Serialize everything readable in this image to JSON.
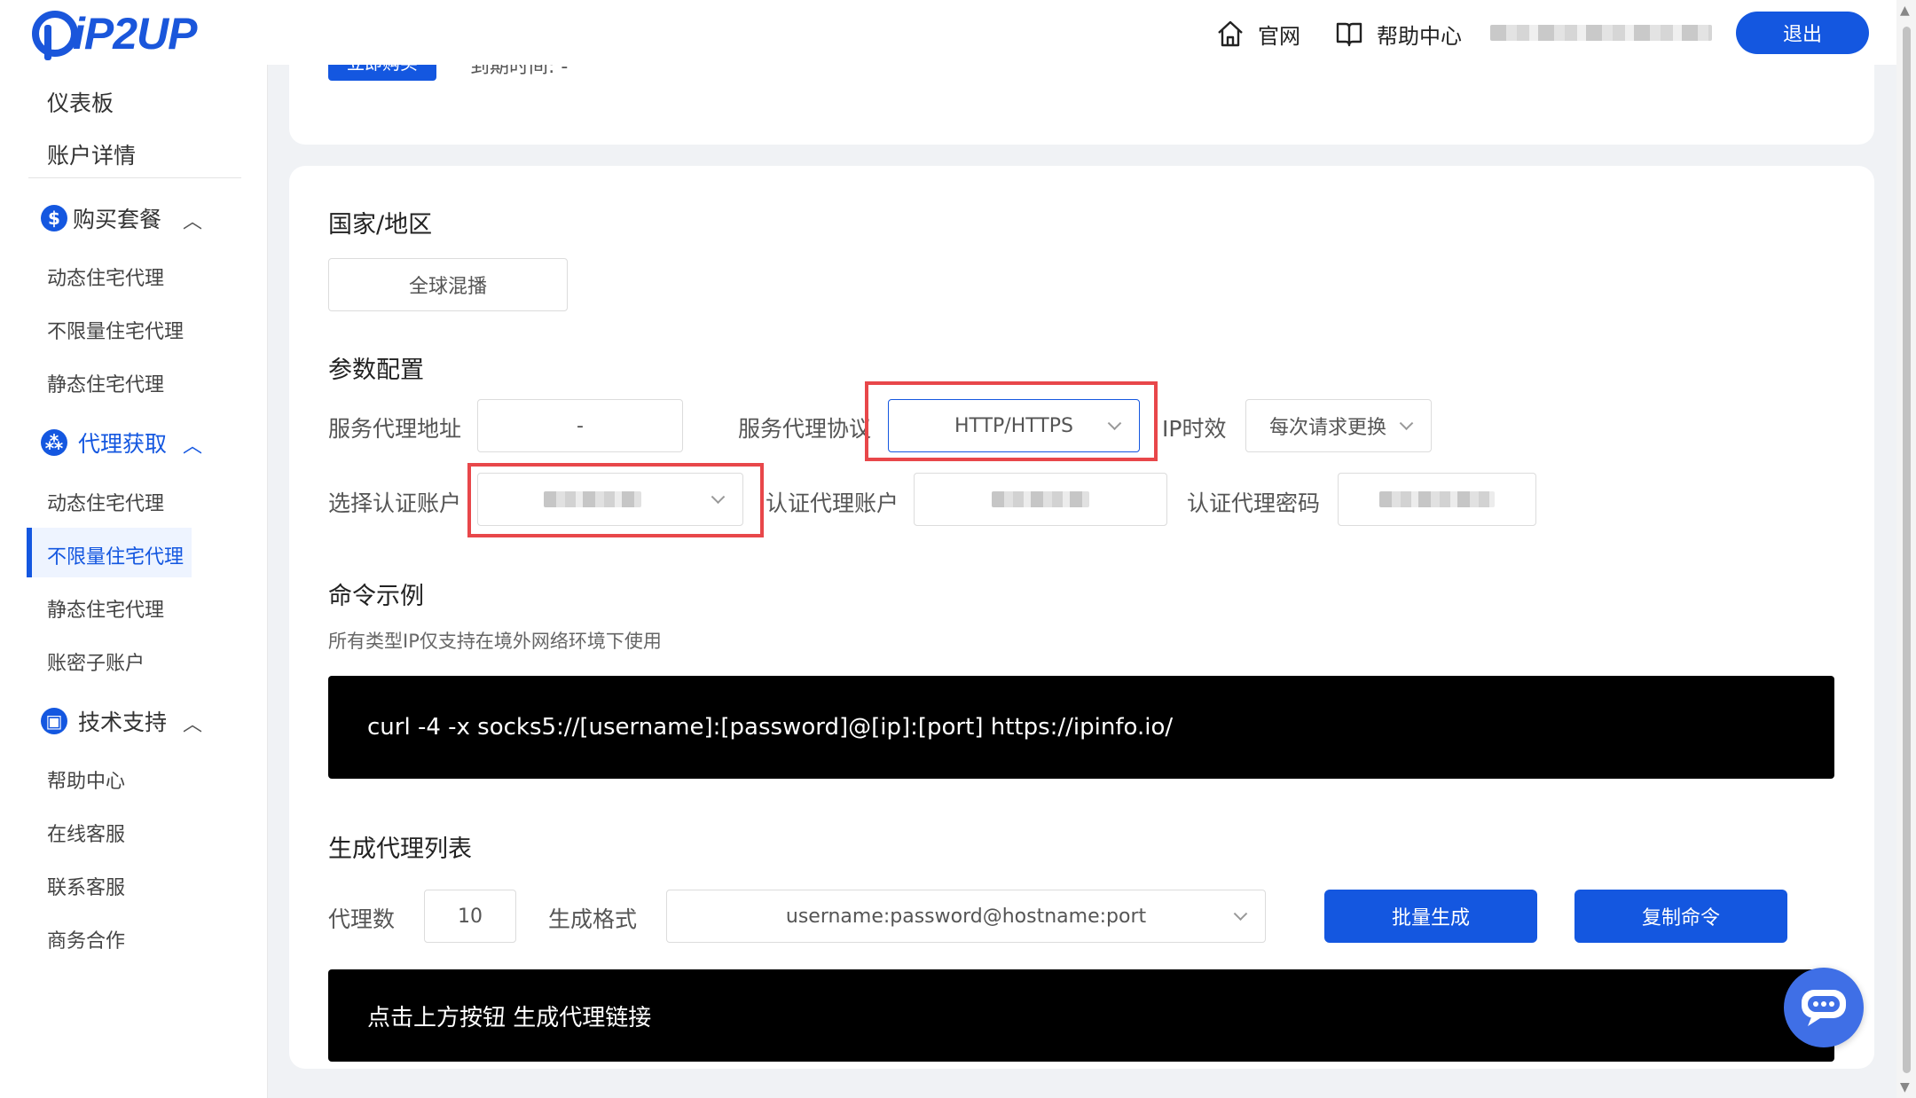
{
  "header": {
    "logo_text": "iP2UP",
    "links": [
      {
        "label": "官网",
        "icon": "home-icon"
      },
      {
        "label": "帮助中心",
        "icon": "book-icon"
      }
    ],
    "logout_label": "退出"
  },
  "sidebar": {
    "top_items": [
      "仪表板",
      "账户详情"
    ],
    "groups": [
      {
        "label": "购买套餐",
        "icon": "dollar-icon",
        "items": [
          "动态住宅代理",
          "不限量住宅代理",
          "静态住宅代理"
        ]
      },
      {
        "label": "代理获取",
        "icon": "network-icon",
        "items": [
          "动态住宅代理",
          "不限量住宅代理",
          "静态住宅代理",
          "账密子账户"
        ]
      },
      {
        "label": "技术支持",
        "icon": "support-icon",
        "items": [
          "帮助中心",
          "在线客服",
          "联系客服",
          "商务合作"
        ]
      }
    ],
    "active_item": "不限量住宅代理"
  },
  "top_card": {
    "buy_label": "立即购买",
    "expire_label": "到期时间: -"
  },
  "main": {
    "region": {
      "title": "国家/地区",
      "value": "全球混播"
    },
    "params": {
      "title": "参数配置",
      "server_label": "服务代理地址",
      "server_value": "-",
      "protocol_label": "服务代理协议",
      "protocol_value": "HTTP/HTTPS",
      "ip_life_label": "IP时效",
      "ip_life_value": "每次请求更换",
      "auth_select_label": "选择认证账户",
      "auth_user_label": "认证代理账户",
      "auth_pass_label": "认证代理密码"
    },
    "example": {
      "title": "命令示例",
      "note": "所有类型IP仅支持在境外网络环境下使用",
      "command": "curl -4 -x socks5://[username]:[password]@[ip]:[port] https://ipinfo.io/"
    },
    "generate": {
      "title": "生成代理列表",
      "count_label": "代理数",
      "count_value": "10",
      "format_label": "生成格式",
      "format_value": "username:password@hostname:port",
      "batch_label": "批量生成",
      "copy_label": "复制命令",
      "output": "点击上方按钮 生成代理链接"
    }
  },
  "colors": {
    "primary": "#1457e0",
    "highlight": "#e8474a",
    "terminal": "#000000"
  }
}
